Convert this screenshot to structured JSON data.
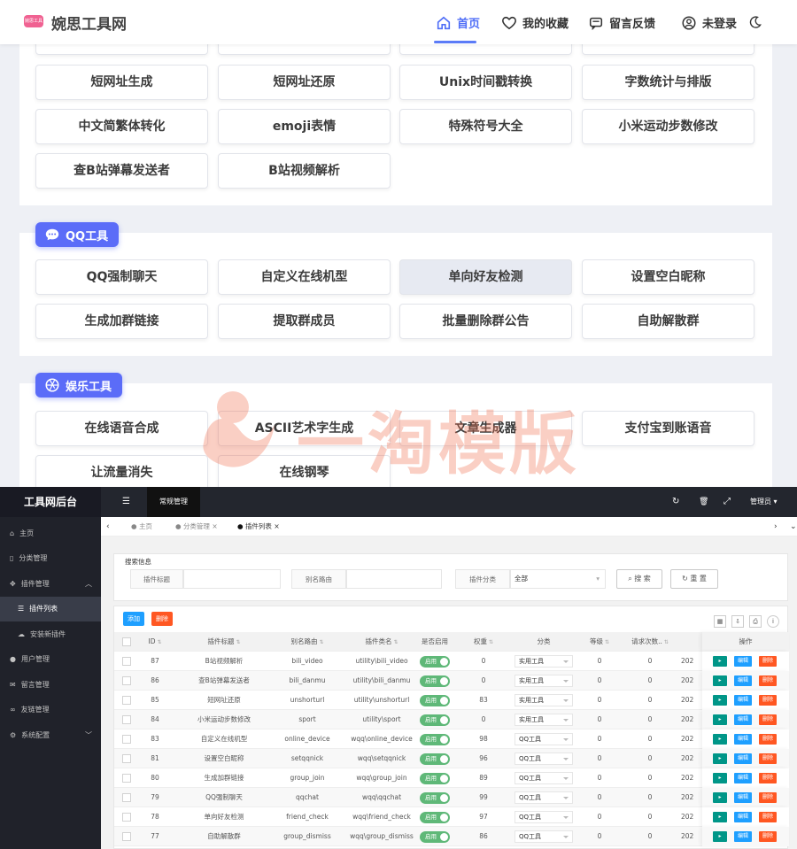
{
  "front": {
    "logo_badge": "婉思工具",
    "brand": "婉思工具网",
    "nav": [
      {
        "label": "首页",
        "icon": "home-icon"
      },
      {
        "label": "我的收藏",
        "icon": "heart-icon"
      },
      {
        "label": "留言反馈",
        "icon": "message-icon"
      },
      {
        "label": "未登录",
        "icon": "user-icon"
      }
    ],
    "tools_top": [
      "短网址生成",
      "短网址还原",
      "Unix时间戳转换",
      "字数统计与排版",
      "中文简繁体转化",
      "emoji表情",
      "特殊符号大全",
      "小米运动步数修改",
      "查B站弹幕发送者",
      "B站视频解析"
    ],
    "qq_section": {
      "title": "QQ工具",
      "tools": [
        "QQ强制聊天",
        "自定义在线机型",
        "单向好友检测",
        "设置空白昵称",
        "生成加群链接",
        "提取群成员",
        "批量删除群公告",
        "自助解散群"
      ]
    },
    "fun_section": {
      "title": "娱乐工具",
      "tools": [
        "在线语音合成",
        "ASCII艺术字生成",
        "文章生成器",
        "支付宝到账语音",
        "让流量消失",
        "在线钢琴"
      ]
    },
    "watermark": "一淘模版"
  },
  "admin": {
    "title": "工具网后台",
    "top_menu": "常规管理",
    "user": "管理员",
    "sidebar": [
      {
        "label": "主页"
      },
      {
        "label": "分类管理"
      },
      {
        "label": "插件管理"
      },
      {
        "label": "插件列表"
      },
      {
        "label": "安装新插件"
      },
      {
        "label": "用户管理"
      },
      {
        "label": "留言管理"
      },
      {
        "label": "友链管理"
      },
      {
        "label": "系统配置"
      }
    ],
    "tabs": [
      "主页",
      "分类管理",
      "插件列表"
    ],
    "search": {
      "legend": "搜索信息",
      "title_label": "插件标题",
      "alias_label": "别名路由",
      "cat_label": "插件分类",
      "cat_value": "全部",
      "search_btn": "搜 索",
      "reset_btn": "重 置"
    },
    "actions": {
      "add": "添加",
      "delete": "删除"
    },
    "columns": [
      "ID",
      "插件标题",
      "别名路由",
      "插件类名",
      "是否启用",
      "权重",
      "分类",
      "等级",
      "请求次数..",
      "操作"
    ],
    "row_buttons": {
      "edit": "编辑",
      "del": "删除"
    },
    "switch_on": "启用",
    "date_prefix": "202",
    "rows": [
      {
        "id": "87",
        "title": "B站视频解析",
        "alias": "bili_video",
        "cls": "utility\\bili_video",
        "weight": "0",
        "cat": "实用工具",
        "level": "0",
        "req": "0"
      },
      {
        "id": "86",
        "title": "查B站弹幕发送者",
        "alias": "bili_danmu",
        "cls": "utility\\bili_danmu",
        "weight": "0",
        "cat": "实用工具",
        "level": "0",
        "req": "0"
      },
      {
        "id": "85",
        "title": "短网址还原",
        "alias": "unshorturl",
        "cls": "utility\\unshorturl",
        "weight": "83",
        "cat": "实用工具",
        "level": "0",
        "req": "0"
      },
      {
        "id": "84",
        "title": "小米运动步数修改",
        "alias": "sport",
        "cls": "utility\\sport",
        "weight": "0",
        "cat": "实用工具",
        "level": "0",
        "req": "0"
      },
      {
        "id": "83",
        "title": "自定义在线机型",
        "alias": "online_device",
        "cls": "wqq\\online_device",
        "weight": "98",
        "cat": "QQ工具",
        "level": "0",
        "req": "0"
      },
      {
        "id": "81",
        "title": "设置空白昵称",
        "alias": "setqqnick",
        "cls": "wqq\\setqqnick",
        "weight": "96",
        "cat": "QQ工具",
        "level": "0",
        "req": "0"
      },
      {
        "id": "80",
        "title": "生成加群链接",
        "alias": "group_join",
        "cls": "wqq\\group_join",
        "weight": "89",
        "cat": "QQ工具",
        "level": "0",
        "req": "0"
      },
      {
        "id": "79",
        "title": "QQ强制聊天",
        "alias": "qqchat",
        "cls": "wqq\\qqchat",
        "weight": "99",
        "cat": "QQ工具",
        "level": "0",
        "req": "0"
      },
      {
        "id": "78",
        "title": "单向好友检测",
        "alias": "friend_check",
        "cls": "wqq\\friend_check",
        "weight": "97",
        "cat": "QQ工具",
        "level": "0",
        "req": "0"
      },
      {
        "id": "77",
        "title": "自助解散群",
        "alias": "group_dismiss",
        "cls": "wqq\\group_dismiss",
        "weight": "86",
        "cat": "QQ工具",
        "level": "0",
        "req": "0"
      }
    ]
  }
}
